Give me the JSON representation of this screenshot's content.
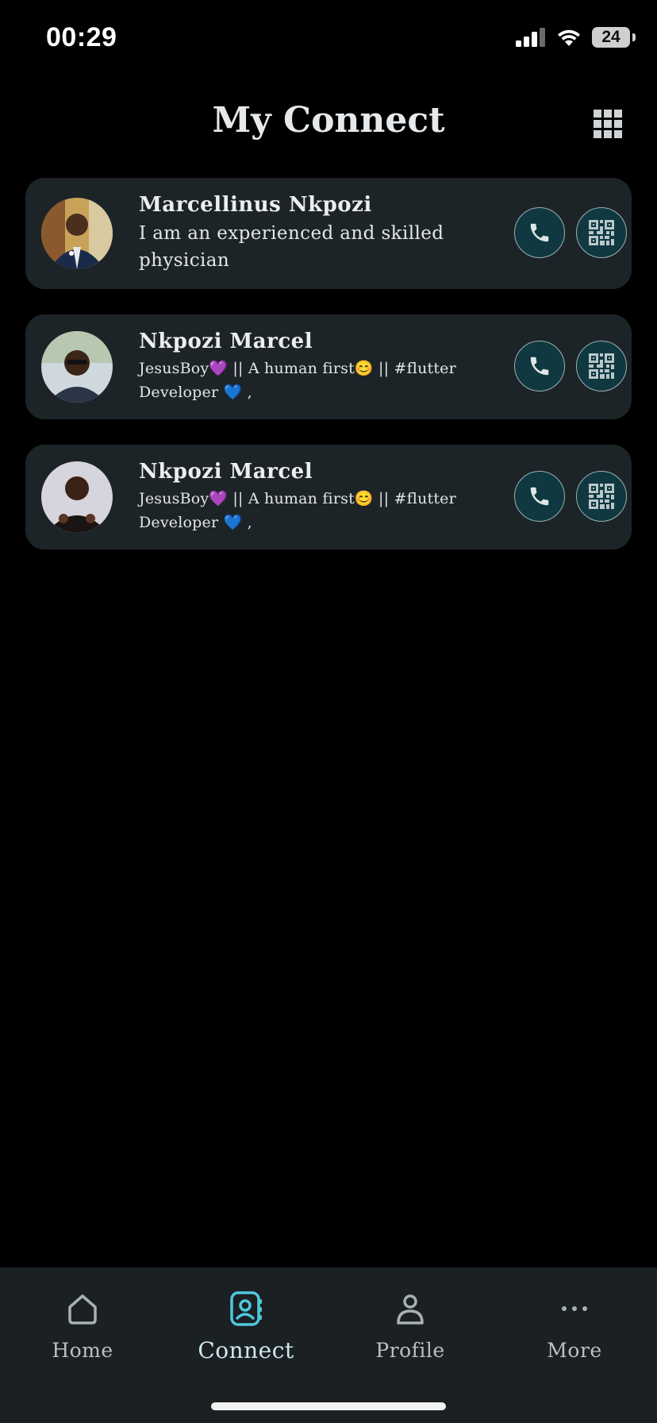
{
  "status_bar": {
    "time": "00:29",
    "battery": "24"
  },
  "header": {
    "title": "My Connect"
  },
  "connections": [
    {
      "name": "Marcellinus Nkpozi",
      "bio_line1": "I am an experienced and skilled",
      "bio_line2": "physician"
    },
    {
      "name": "Nkpozi Marcel",
      "bio_line1": "JesusBoy💜 || A human first😊 || #flutter",
      "bio_line2": "Developer 💙 ,"
    },
    {
      "name": "Nkpozi Marcel",
      "bio_line1": "JesusBoy💜 || A human first😊 || #flutter",
      "bio_line2": "Developer 💙 ,"
    }
  ],
  "tabs": [
    {
      "label": "Home",
      "icon": "home-icon"
    },
    {
      "label": "Connect",
      "icon": "contact-book-icon",
      "active": true
    },
    {
      "label": "Profile",
      "icon": "person-icon"
    },
    {
      "label": "More",
      "icon": "more-dots-icon"
    }
  ],
  "colors": {
    "background": "#000000",
    "card": "#1d2428",
    "accent": "#4fc7dd",
    "action_button": "#0f3840"
  }
}
